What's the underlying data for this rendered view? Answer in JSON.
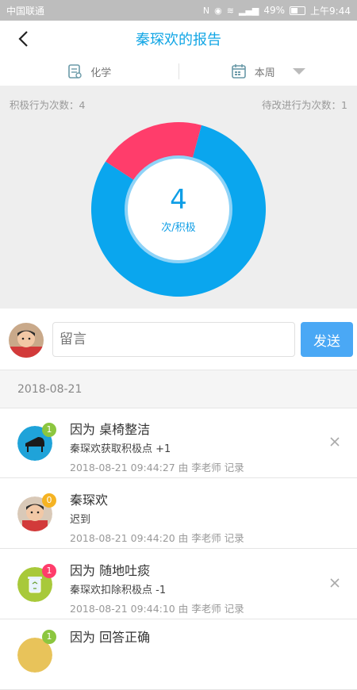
{
  "status_bar": {
    "carrier": "中国联通",
    "signal_label": "4G",
    "battery": "49%",
    "time": "上午9:44"
  },
  "header": {
    "title": "秦琛欢的报告"
  },
  "filters": {
    "subject": "化学",
    "period": "本周"
  },
  "summary": {
    "positive_label": "积极行为次数：4",
    "improve_label": "待改进行为次数：1",
    "center_value": "4",
    "center_unit": "次/积极"
  },
  "chart_data": {
    "type": "pie",
    "categories": [
      "积极行为",
      "待改进行为"
    ],
    "values": [
      4,
      1
    ],
    "colors": [
      "#0aa6ee",
      "#ff3d6b"
    ]
  },
  "comment": {
    "placeholder": "留言",
    "send_label": "发送"
  },
  "date_group": "2018-08-21",
  "records": [
    {
      "icon": "piano-icon",
      "badge": "1",
      "badge_color": "#8cc63f",
      "icon_color": "#1fa3d9",
      "title": "因为 桌椅整洁",
      "detail": "秦琛欢获取积极点 +1",
      "meta": "2018-08-21 09:44:27 由 李老师 记录"
    },
    {
      "icon": "student-avatar",
      "badge": "0",
      "badge_color": "#f5b323",
      "icon_color": "#d9c9b8",
      "title": "秦琛欢",
      "detail": "迟到",
      "meta": "2018-08-21 09:44:20 由 李老师 记录"
    },
    {
      "icon": "trash-can-icon",
      "badge": "1",
      "badge_color": "#ff3d6b",
      "icon_color": "#a8c93a",
      "title": "因为 随地吐痰",
      "detail": "秦琛欢扣除积极点 -1",
      "meta": "2018-08-21 09:44:10 由 李老师 记录"
    }
  ],
  "partial_record": {
    "badge": "1",
    "badge_color": "#8cc63f",
    "icon_color": "#e8c35a",
    "title": "因为 回答正确"
  }
}
